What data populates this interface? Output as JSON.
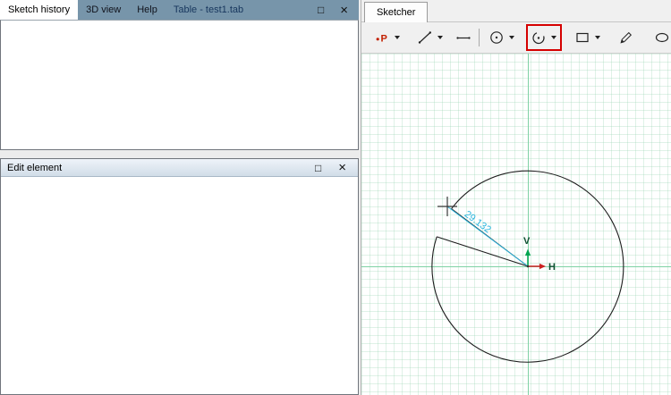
{
  "colors": {
    "tabbar_blue": "#7795aa",
    "highlight_red": "#d50000",
    "dimension_cyan": "#2ab4de",
    "axis_green": "#7fd2a5",
    "h_arrow_red": "#cc2222",
    "v_arrow_green": "#00a550"
  },
  "left_top_panel": {
    "tabs": [
      {
        "label": "Sketch history",
        "active": true
      },
      {
        "label": "3D view",
        "active": false
      },
      {
        "label": "Help",
        "active": false
      },
      {
        "label": "Table - test1.tab",
        "active": false
      }
    ],
    "maximize_glyph": "□",
    "close_glyph": "×"
  },
  "edit_panel": {
    "title": "Edit element",
    "maximize_glyph": "□",
    "close_glyph": "×"
  },
  "sketcher_panel": {
    "tab_label": "Sketcher",
    "toolbar": {
      "tools": [
        {
          "name": "point-tool",
          "glyph": "P",
          "dropdown": true,
          "highlighted": false
        },
        {
          "name": "line-tool",
          "dropdown": true,
          "highlighted": false
        },
        {
          "name": "horizontal-line-tool",
          "dropdown": false,
          "highlighted": false
        },
        {
          "name": "circle-tool",
          "dropdown": true,
          "highlighted": false
        },
        {
          "name": "arc-tool",
          "dropdown": true,
          "highlighted": true
        },
        {
          "name": "rectangle-tool",
          "dropdown": true,
          "highlighted": false
        },
        {
          "name": "spline-tool",
          "dropdown": false,
          "highlighted": false
        },
        {
          "name": "ellipse-tool",
          "dropdown": false,
          "highlighted": false
        }
      ]
    },
    "canvas": {
      "dimension_label": "29.132",
      "h_axis_label": "H",
      "v_axis_label": "V"
    }
  }
}
